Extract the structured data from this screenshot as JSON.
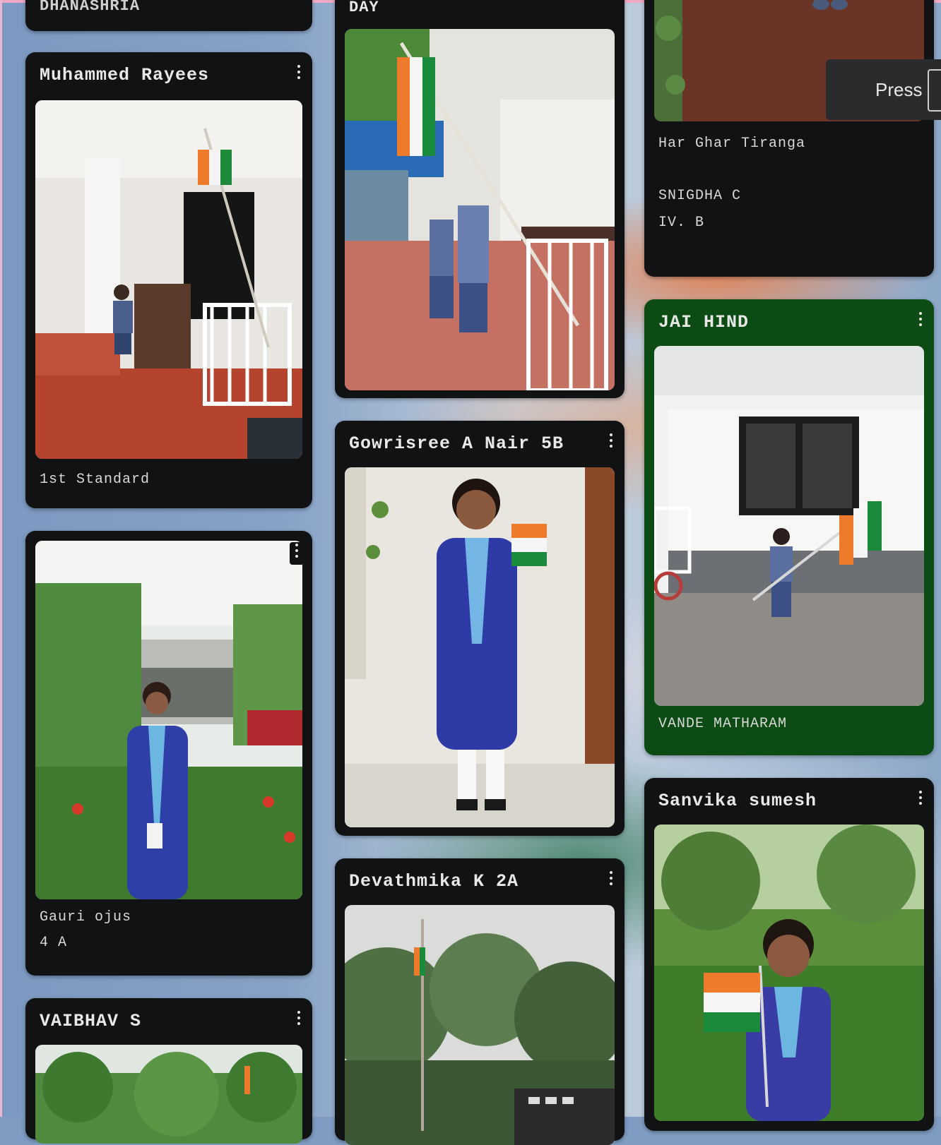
{
  "cards": {
    "c0": {
      "title": "DHANASHRIA"
    },
    "c1": {
      "title": "DAY"
    },
    "c2": {
      "captions": [
        "Har Ghar Tiranga",
        "SNIGDHA C",
        "IV. B"
      ]
    },
    "rayees": {
      "title": "Muhammed Rayees",
      "caption": "1st Standard"
    },
    "gauri": {
      "captions": [
        "Gauri ojus",
        "4 A"
      ]
    },
    "vaibhav": {
      "title": "VAIBHAV S"
    },
    "gowri": {
      "title": "Gowrisree A Nair 5B"
    },
    "deva": {
      "title": "Devathmika K 2A"
    },
    "jai": {
      "title": "JAI HIND",
      "caption": "VANDE MATHARAM"
    },
    "sanvika": {
      "title": "Sanvika sumesh"
    }
  },
  "overlay": {
    "press_label": "Press"
  },
  "icons": {
    "menu": "more-vertical-icon"
  },
  "colors": {
    "card": "#111214",
    "card_green": "#0c4b14",
    "background": "#7f9cc2"
  }
}
